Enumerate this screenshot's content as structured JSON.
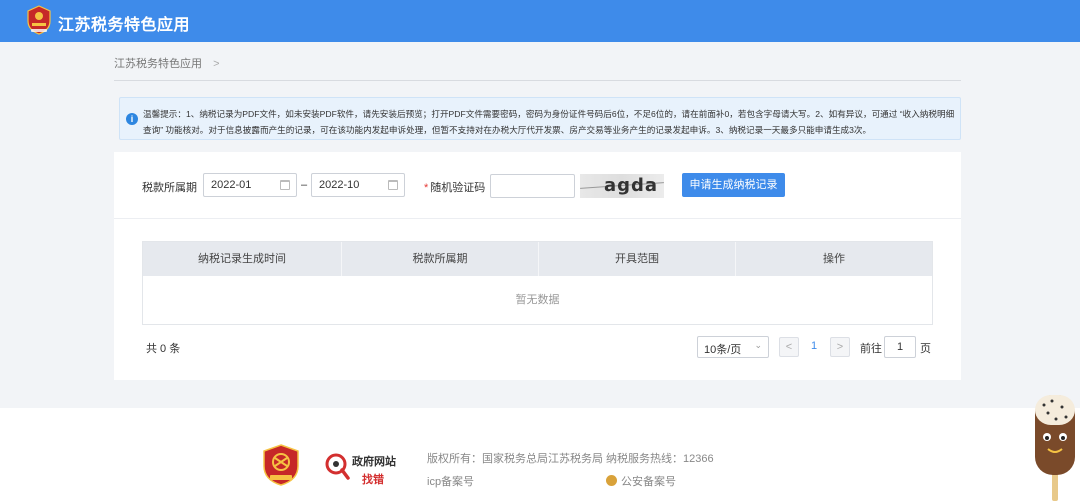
{
  "header": {
    "title": "江苏税务特色应用"
  },
  "breadcrumb": {
    "item": "江苏税务特色应用",
    "separator": ">"
  },
  "notice": {
    "text": "温馨提示：1、纳税记录为PDF文件，如未安装PDF软件，请先安装后预览；打开PDF文件需要密码，密码为身份证件号码后6位，不足6位的，请在前面补0，若包含字母请大写。2、如有异议，可通过 “收入纳税明细查询” 功能核对。对于信息披露而产生的记录，可在该功能内发起申诉处理，但暂不支持对在办税大厅代开发票、房产交易等业务产生的记录发起申诉。3、纳税记录一天最多只能申请生成3次。"
  },
  "form": {
    "period_label": "税款所属期",
    "start_date": "2022-01",
    "end_date": "2022-10",
    "dash": "–",
    "captcha_required_mark": "*",
    "captcha_label": "随机验证码",
    "captcha_value": "",
    "captcha_image_text": "agda",
    "submit_label": "申请生成纳税记录"
  },
  "table": {
    "columns": [
      "纳税记录生成时间",
      "税款所属期",
      "开具范围",
      "操作"
    ],
    "rows": [],
    "empty_text": "暂无数据"
  },
  "pagination": {
    "total_text": "共 0 条",
    "page_size": "10条/页",
    "prev": "<",
    "current_page": "1",
    "next": ">",
    "goto_label": "前往",
    "goto_value": "1",
    "goto_unit": "页"
  },
  "footer": {
    "gov_site_line1": "政府网站",
    "gov_site_line2": "找错",
    "copyright": "版权所有：国家税务总局江苏税务局",
    "hotline": "纳税服务热线：12366",
    "icp": "icp备案号",
    "police": "公安备案号"
  },
  "colors": {
    "brand": "#3e8bea",
    "notice_bg": "#e8f2fc",
    "required": "#e53935"
  }
}
